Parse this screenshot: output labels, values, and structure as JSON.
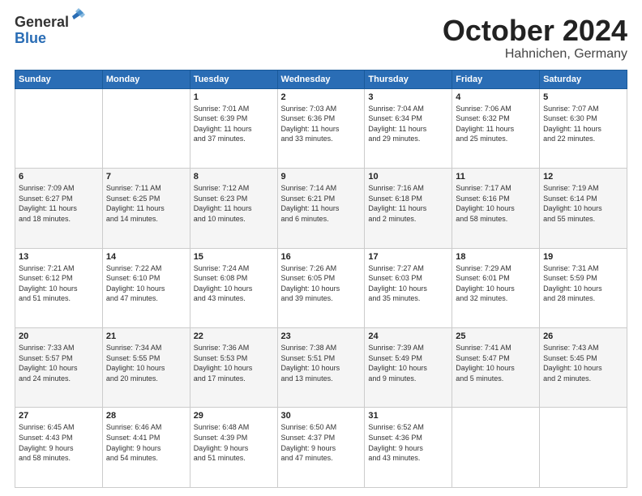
{
  "logo": {
    "general": "General",
    "blue": "Blue"
  },
  "header": {
    "month": "October 2024",
    "location": "Hahnichen, Germany"
  },
  "weekdays": [
    "Sunday",
    "Monday",
    "Tuesday",
    "Wednesday",
    "Thursday",
    "Friday",
    "Saturday"
  ],
  "weeks": [
    [
      {
        "day": "",
        "info": ""
      },
      {
        "day": "",
        "info": ""
      },
      {
        "day": "1",
        "info": "Sunrise: 7:01 AM\nSunset: 6:39 PM\nDaylight: 11 hours\nand 37 minutes."
      },
      {
        "day": "2",
        "info": "Sunrise: 7:03 AM\nSunset: 6:36 PM\nDaylight: 11 hours\nand 33 minutes."
      },
      {
        "day": "3",
        "info": "Sunrise: 7:04 AM\nSunset: 6:34 PM\nDaylight: 11 hours\nand 29 minutes."
      },
      {
        "day": "4",
        "info": "Sunrise: 7:06 AM\nSunset: 6:32 PM\nDaylight: 11 hours\nand 25 minutes."
      },
      {
        "day": "5",
        "info": "Sunrise: 7:07 AM\nSunset: 6:30 PM\nDaylight: 11 hours\nand 22 minutes."
      }
    ],
    [
      {
        "day": "6",
        "info": "Sunrise: 7:09 AM\nSunset: 6:27 PM\nDaylight: 11 hours\nand 18 minutes."
      },
      {
        "day": "7",
        "info": "Sunrise: 7:11 AM\nSunset: 6:25 PM\nDaylight: 11 hours\nand 14 minutes."
      },
      {
        "day": "8",
        "info": "Sunrise: 7:12 AM\nSunset: 6:23 PM\nDaylight: 11 hours\nand 10 minutes."
      },
      {
        "day": "9",
        "info": "Sunrise: 7:14 AM\nSunset: 6:21 PM\nDaylight: 11 hours\nand 6 minutes."
      },
      {
        "day": "10",
        "info": "Sunrise: 7:16 AM\nSunset: 6:18 PM\nDaylight: 11 hours\nand 2 minutes."
      },
      {
        "day": "11",
        "info": "Sunrise: 7:17 AM\nSunset: 6:16 PM\nDaylight: 10 hours\nand 58 minutes."
      },
      {
        "day": "12",
        "info": "Sunrise: 7:19 AM\nSunset: 6:14 PM\nDaylight: 10 hours\nand 55 minutes."
      }
    ],
    [
      {
        "day": "13",
        "info": "Sunrise: 7:21 AM\nSunset: 6:12 PM\nDaylight: 10 hours\nand 51 minutes."
      },
      {
        "day": "14",
        "info": "Sunrise: 7:22 AM\nSunset: 6:10 PM\nDaylight: 10 hours\nand 47 minutes."
      },
      {
        "day": "15",
        "info": "Sunrise: 7:24 AM\nSunset: 6:08 PM\nDaylight: 10 hours\nand 43 minutes."
      },
      {
        "day": "16",
        "info": "Sunrise: 7:26 AM\nSunset: 6:05 PM\nDaylight: 10 hours\nand 39 minutes."
      },
      {
        "day": "17",
        "info": "Sunrise: 7:27 AM\nSunset: 6:03 PM\nDaylight: 10 hours\nand 35 minutes."
      },
      {
        "day": "18",
        "info": "Sunrise: 7:29 AM\nSunset: 6:01 PM\nDaylight: 10 hours\nand 32 minutes."
      },
      {
        "day": "19",
        "info": "Sunrise: 7:31 AM\nSunset: 5:59 PM\nDaylight: 10 hours\nand 28 minutes."
      }
    ],
    [
      {
        "day": "20",
        "info": "Sunrise: 7:33 AM\nSunset: 5:57 PM\nDaylight: 10 hours\nand 24 minutes."
      },
      {
        "day": "21",
        "info": "Sunrise: 7:34 AM\nSunset: 5:55 PM\nDaylight: 10 hours\nand 20 minutes."
      },
      {
        "day": "22",
        "info": "Sunrise: 7:36 AM\nSunset: 5:53 PM\nDaylight: 10 hours\nand 17 minutes."
      },
      {
        "day": "23",
        "info": "Sunrise: 7:38 AM\nSunset: 5:51 PM\nDaylight: 10 hours\nand 13 minutes."
      },
      {
        "day": "24",
        "info": "Sunrise: 7:39 AM\nSunset: 5:49 PM\nDaylight: 10 hours\nand 9 minutes."
      },
      {
        "day": "25",
        "info": "Sunrise: 7:41 AM\nSunset: 5:47 PM\nDaylight: 10 hours\nand 5 minutes."
      },
      {
        "day": "26",
        "info": "Sunrise: 7:43 AM\nSunset: 5:45 PM\nDaylight: 10 hours\nand 2 minutes."
      }
    ],
    [
      {
        "day": "27",
        "info": "Sunrise: 6:45 AM\nSunset: 4:43 PM\nDaylight: 9 hours\nand 58 minutes."
      },
      {
        "day": "28",
        "info": "Sunrise: 6:46 AM\nSunset: 4:41 PM\nDaylight: 9 hours\nand 54 minutes."
      },
      {
        "day": "29",
        "info": "Sunrise: 6:48 AM\nSunset: 4:39 PM\nDaylight: 9 hours\nand 51 minutes."
      },
      {
        "day": "30",
        "info": "Sunrise: 6:50 AM\nSunset: 4:37 PM\nDaylight: 9 hours\nand 47 minutes."
      },
      {
        "day": "31",
        "info": "Sunrise: 6:52 AM\nSunset: 4:36 PM\nDaylight: 9 hours\nand 43 minutes."
      },
      {
        "day": "",
        "info": ""
      },
      {
        "day": "",
        "info": ""
      }
    ]
  ]
}
